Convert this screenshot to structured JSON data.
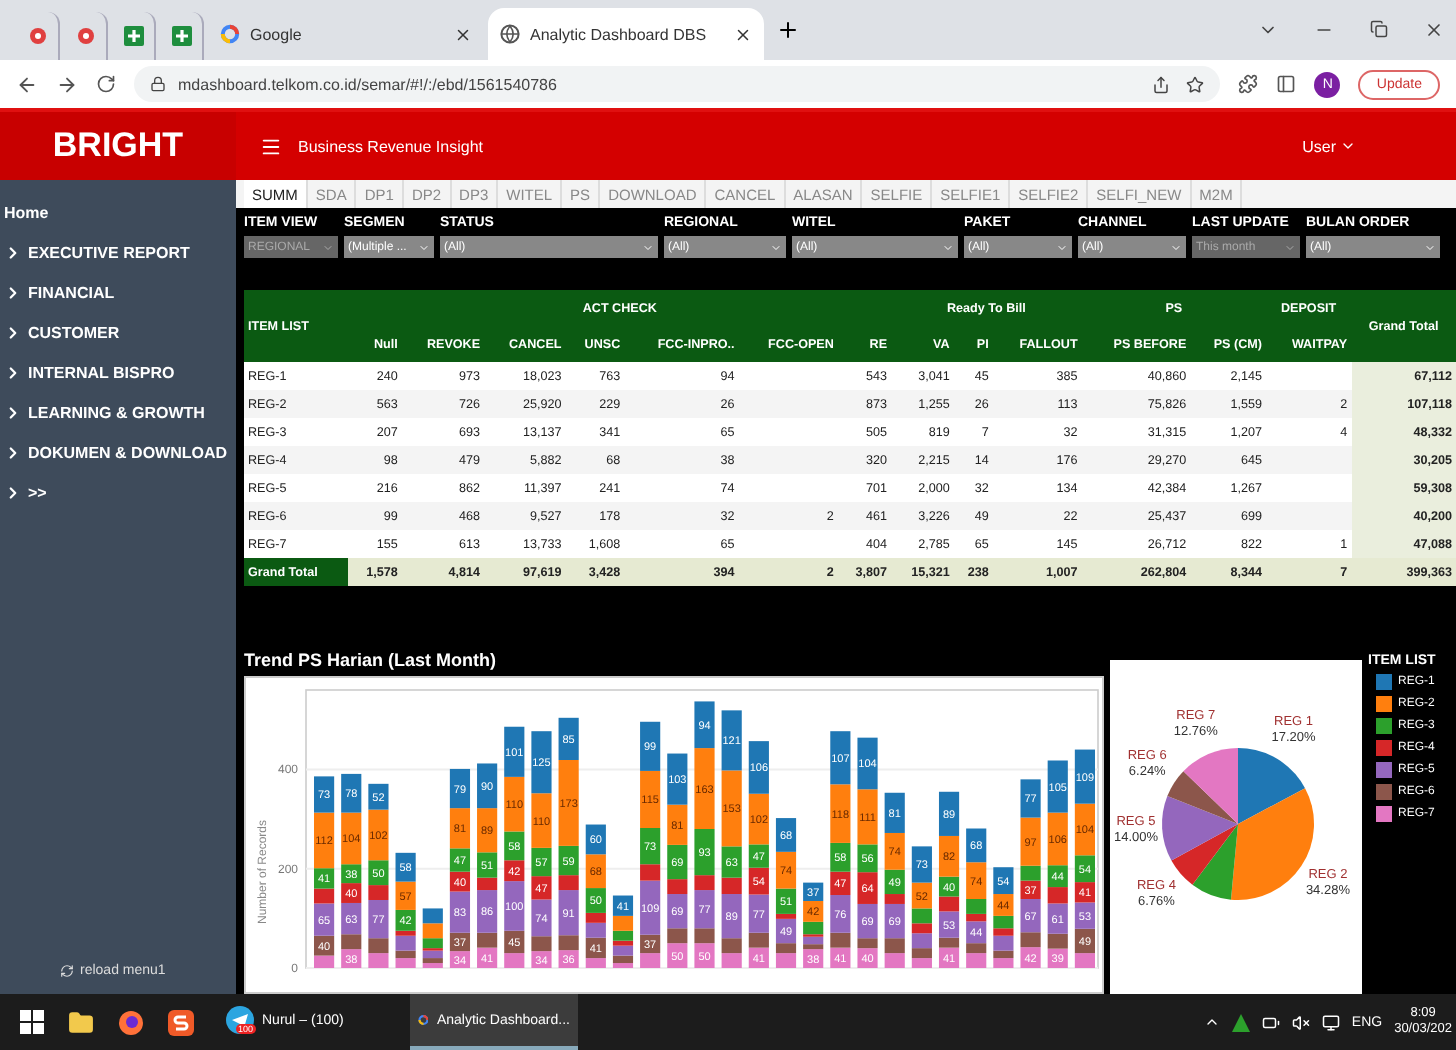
{
  "browser": {
    "tabs": [
      {
        "kind": "pinned",
        "selected": false
      },
      {
        "kind": "pinned",
        "selected": false
      },
      {
        "kind": "pinned",
        "selected": false
      },
      {
        "kind": "pinned",
        "selected": false
      },
      {
        "kind": "page",
        "title": "Google",
        "selected": false
      },
      {
        "kind": "page",
        "title": "Analytic Dashboard DBS",
        "selected": true
      }
    ],
    "url": "mdashboard.telkom.co.id/semar/#!/:/ebd/1561540786",
    "profile": "N",
    "update": "Update"
  },
  "header": {
    "brand": "BRIGHT",
    "subtitle": "Business Revenue Insight",
    "user": "User"
  },
  "sidebar": {
    "items": [
      {
        "label": "Home",
        "kind": "plain"
      },
      {
        "label": "EXECUTIVE REPORT",
        "kind": "menu"
      },
      {
        "label": "FINANCIAL",
        "kind": "menu"
      },
      {
        "label": "CUSTOMER",
        "kind": "menu"
      },
      {
        "label": "INTERNAL BISPRO",
        "kind": "menu"
      },
      {
        "label": "LEARNING & GROWTH",
        "kind": "menu"
      },
      {
        "label": "DOKUMEN & DOWNLOAD",
        "kind": "menu"
      },
      {
        "label": ">>",
        "kind": "menu"
      }
    ],
    "reload": "reload menu1"
  },
  "tabs": [
    {
      "label": "SUMM",
      "selected": true
    },
    {
      "label": "SDA",
      "selected": false
    },
    {
      "label": "DP1",
      "selected": false
    },
    {
      "label": "DP2",
      "selected": false
    },
    {
      "label": "DP3",
      "selected": false
    },
    {
      "label": "WITEL",
      "selected": false
    },
    {
      "label": "PS",
      "selected": false
    },
    {
      "label": "DOWNLOAD",
      "selected": false
    },
    {
      "label": "CANCEL",
      "selected": false
    },
    {
      "label": "ALASAN",
      "selected": false
    },
    {
      "label": "SELFIE",
      "selected": false
    },
    {
      "label": "SELFIE1",
      "selected": false
    },
    {
      "label": "SELFIE2",
      "selected": false
    },
    {
      "label": "SELFI_NEW",
      "selected": false
    },
    {
      "label": "M2M",
      "selected": false
    }
  ],
  "filters": [
    {
      "label": "ITEM VIEW",
      "value": "REGIONAL",
      "disabled": true
    },
    {
      "label": "SEGMEN",
      "value": "(Multiple ...",
      "disabled": false
    },
    {
      "label": "STATUS",
      "value": "(All)",
      "disabled": false
    },
    {
      "label": "REGIONAL",
      "value": "(All)",
      "disabled": false
    },
    {
      "label": "WITEL",
      "value": "(All)",
      "disabled": false
    },
    {
      "label": "PAKET",
      "value": "(All)",
      "disabled": false
    },
    {
      "label": "CHANNEL",
      "value": "(All)",
      "disabled": false
    },
    {
      "label": "LAST UPDATE",
      "value": "This month",
      "disabled": true
    },
    {
      "label": "BULAN ORDER",
      "value": "(All)",
      "disabled": false
    }
  ],
  "table": {
    "groups": [
      "ACT CHECK",
      "Ready To Bill",
      "PS",
      "DEPOSIT"
    ],
    "first_column": "ITEM LIST",
    "last_column": "Grand Total",
    "columns": [
      "Null",
      "REVOKE",
      "CANCEL",
      "UNSC",
      "FCC-INPRO..",
      "FCC-OPEN",
      "RE",
      "VA",
      "PI",
      "FALLOUT",
      "PS BEFORE",
      "PS (CM)",
      "WAITPAY"
    ],
    "rows": [
      {
        "label": "REG-1",
        "cells": [
          "240",
          "973",
          "18,023",
          "763",
          "94",
          null,
          "543",
          "3,041",
          "45",
          "385",
          "40,860",
          "2,145",
          null
        ],
        "total": "67,112"
      },
      {
        "label": "REG-2",
        "cells": [
          "563",
          "726",
          "25,920",
          "229",
          "26",
          null,
          "873",
          "1,255",
          "26",
          "113",
          "75,826",
          "1,559",
          "2"
        ],
        "total": "107,118"
      },
      {
        "label": "REG-3",
        "cells": [
          "207",
          "693",
          "13,137",
          "341",
          "65",
          null,
          "505",
          "819",
          "7",
          "32",
          "31,315",
          "1,207",
          "4"
        ],
        "total": "48,332"
      },
      {
        "label": "REG-4",
        "cells": [
          "98",
          "479",
          "5,882",
          "68",
          "38",
          null,
          "320",
          "2,215",
          "14",
          "176",
          "29,270",
          "645",
          null
        ],
        "total": "30,205"
      },
      {
        "label": "REG-5",
        "cells": [
          "216",
          "862",
          "11,397",
          "241",
          "74",
          null,
          "701",
          "2,000",
          "32",
          "134",
          "42,384",
          "1,267",
          null
        ],
        "total": "59,308"
      },
      {
        "label": "REG-6",
        "cells": [
          "99",
          "468",
          "9,527",
          "178",
          "32",
          "2",
          "461",
          "3,226",
          "49",
          "22",
          "25,437",
          "699",
          null
        ],
        "total": "40,200"
      },
      {
        "label": "REG-7",
        "cells": [
          "155",
          "613",
          "13,733",
          "1,608",
          "65",
          null,
          "404",
          "2,785",
          "65",
          "145",
          "26,712",
          "822",
          "1"
        ],
        "total": "47,088"
      }
    ],
    "grand_total": {
      "label": "Grand Total",
      "cells": [
        "1,578",
        "4,814",
        "97,619",
        "3,428",
        "394",
        "2",
        "3,807",
        "15,321",
        "238",
        "1,007",
        "262,804",
        "8,344",
        "7"
      ],
      "total": "399,363"
    }
  },
  "trend": {
    "title": "Trend PS Harian (Last Month)",
    "chart_data": {
      "type": "bar",
      "stacked": true,
      "ylabel": "Number of Records",
      "yticks": [
        0,
        200,
        400
      ],
      "ylim": [
        0,
        560
      ],
      "series": [
        {
          "name": "REG-7",
          "color": "#e377c2",
          "values": [
            25,
            38,
            30,
            20,
            10,
            34,
            41,
            30,
            34,
            36,
            20,
            10,
            30,
            50,
            50,
            30,
            41,
            30,
            38,
            41,
            40,
            30,
            20,
            41,
            30,
            20,
            42,
            39,
            30
          ],
          "value_labels": [
            null,
            "38",
            null,
            null,
            null,
            "34",
            "41",
            null,
            "34",
            "36",
            null,
            null,
            null,
            "50",
            "50",
            null,
            "41",
            null,
            "38",
            "41",
            "40",
            null,
            null,
            "41",
            null,
            null,
            "42",
            "39",
            null
          ]
        },
        {
          "name": "REG-6",
          "color": "#8c564b",
          "values": [
            40,
            30,
            30,
            15,
            10,
            37,
            30,
            45,
            30,
            30,
            41,
            15,
            37,
            30,
            30,
            30,
            30,
            20,
            10,
            30,
            20,
            30,
            20,
            20,
            20,
            15,
            30,
            30,
            49
          ],
          "value_labels": [
            "40",
            null,
            null,
            null,
            null,
            "37",
            null,
            "45",
            null,
            null,
            "41",
            null,
            "37",
            null,
            null,
            null,
            null,
            null,
            null,
            null,
            null,
            null,
            null,
            null,
            null,
            null,
            null,
            null,
            "49"
          ]
        },
        {
          "name": "REG-5",
          "color": "#9467bd",
          "values": [
            65,
            63,
            77,
            30,
            15,
            83,
            86,
            100,
            74,
            91,
            30,
            20,
            109,
            69,
            77,
            89,
            77,
            49,
            15,
            76,
            69,
            69,
            30,
            53,
            44,
            30,
            67,
            61,
            53
          ],
          "value_labels": [
            "65",
            "63",
            "77",
            null,
            null,
            "83",
            "86",
            "100",
            "74",
            "91",
            null,
            null,
            "109",
            "69",
            "77",
            "89",
            "77",
            "49",
            null,
            "76",
            "69",
            "69",
            null,
            "53",
            "44",
            null,
            "67",
            "61",
            "53"
          ]
        },
        {
          "name": "REG-4",
          "color": "#d62728",
          "values": [
            30,
            40,
            30,
            10,
            5,
            40,
            25,
            42,
            47,
            30,
            20,
            10,
            33,
            30,
            30,
            33,
            54,
            10,
            5,
            47,
            64,
            20,
            20,
            30,
            15,
            15,
            37,
            33,
            41
          ],
          "value_labels": [
            null,
            "40",
            null,
            null,
            null,
            "40",
            null,
            "42",
            "47",
            null,
            null,
            null,
            null,
            null,
            null,
            null,
            "54",
            null,
            null,
            "47",
            "64",
            null,
            null,
            null,
            null,
            null,
            "37",
            null,
            "41"
          ]
        },
        {
          "name": "REG-3",
          "color": "#2ca02c",
          "values": [
            41,
            38,
            50,
            42,
            20,
            47,
            51,
            58,
            57,
            59,
            50,
            20,
            73,
            69,
            93,
            63,
            47,
            51,
            25,
            58,
            56,
            49,
            30,
            40,
            30,
            25,
            30,
            44,
            54
          ],
          "value_labels": [
            "41",
            "38",
            "50",
            "42",
            null,
            "47",
            "51",
            "58",
            "57",
            "59",
            "50",
            null,
            "73",
            "69",
            "93",
            "63",
            "47",
            "51",
            null,
            "58",
            "56",
            "49",
            null,
            "40",
            null,
            null,
            null,
            "44",
            "54"
          ]
        },
        {
          "name": "REG-2",
          "color": "#ff7f0e",
          "values": [
            112,
            104,
            102,
            57,
            30,
            81,
            89,
            110,
            110,
            173,
            68,
            30,
            115,
            81,
            163,
            153,
            102,
            74,
            42,
            118,
            111,
            74,
            52,
            82,
            74,
            44,
            97,
            106,
            104
          ],
          "value_labels": [
            "112",
            "104",
            "102",
            "57",
            null,
            "81",
            "89",
            "110",
            "110",
            "173",
            "68",
            null,
            "115",
            "81",
            "163",
            "153",
            "102",
            "74",
            "42",
            "118",
            "111",
            "74",
            "52",
            "82",
            "74",
            "44",
            "97",
            "106",
            "104"
          ]
        },
        {
          "name": "REG-1",
          "color": "#1f77b4",
          "values": [
            73,
            78,
            52,
            58,
            30,
            79,
            90,
            101,
            125,
            85,
            60,
            41,
            99,
            103,
            94,
            121,
            106,
            68,
            37,
            107,
            104,
            81,
            73,
            89,
            68,
            54,
            77,
            105,
            109
          ],
          "value_labels": [
            "73",
            "78",
            "52",
            "58",
            null,
            "79",
            "90",
            "101",
            "125",
            "85",
            "60",
            "41",
            "99",
            "103",
            "94",
            "121",
            "106",
            "68",
            "37",
            "107",
            "104",
            "81",
            "73",
            "89",
            "68",
            "54",
            "77",
            "105",
            "109"
          ]
        }
      ]
    }
  },
  "share": {
    "chart_data": {
      "type": "pie",
      "categories": [
        "REG 1",
        "REG 2",
        null,
        "REG 4",
        "REG 5",
        "REG 6",
        "REG 7"
      ],
      "values": [
        17.2,
        34.28,
        8.76,
        6.76,
        14.0,
        6.24,
        12.76
      ],
      "value_labels": [
        "17.20%",
        "34.28%",
        null,
        "6.76%",
        "14.00%",
        "6.24%",
        "12.76%"
      ]
    }
  },
  "legend": {
    "title": "ITEM LIST"
  },
  "taskbar": {
    "apps": [
      {
        "label": "Nurul – (100)",
        "badge": "100",
        "selected": false
      },
      {
        "label": "Analytic Dashboard...",
        "selected": true
      }
    ],
    "language": "ENG",
    "time": "8:09",
    "date": "30/03/202"
  }
}
